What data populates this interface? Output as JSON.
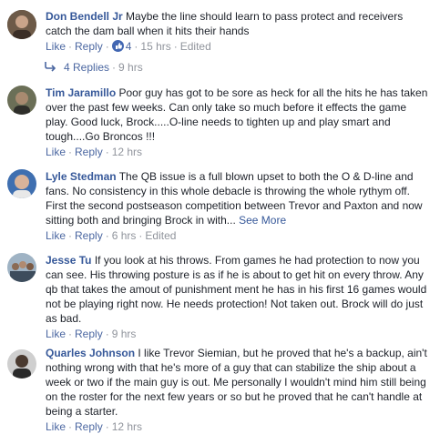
{
  "comments": [
    {
      "author": "Don Bendell Jr",
      "text": "Maybe the line should learn to pass protect and receivers catch the dam ball when it hits their hands",
      "like_label": "Like",
      "reply_label": "Reply",
      "reaction_count": "4",
      "time": "15 hrs",
      "edited": "Edited",
      "avatar_color": "#5a4a3c"
    },
    {
      "author": "Tim Jaramillo",
      "text": "Poor guy has got to be sore as heck for all the hits he has taken over the past few weeks. Can only take so much before it effects the game play. Good luck, Brock.....O-line needs to tighten up and play smart and tough....Go Broncos !!!",
      "like_label": "Like",
      "reply_label": "Reply",
      "time": "12 hrs",
      "avatar_color": "#6b6f57"
    },
    {
      "author": "Lyle Stedman",
      "text": "The QB issue is a full blown upset to both the O & D-line and fans. No consistency in this whole debacle is throwing the whole rythym off. First the second postseason competition between Trevor and Paxton and now sitting both and bringing Brock in with...",
      "see_more": "See More",
      "like_label": "Like",
      "reply_label": "Reply",
      "time": "6 hrs",
      "edited": "Edited",
      "avatar_color": "#3f6fb0"
    },
    {
      "author": "Jesse Tu",
      "text": "If you look at his throws. From games he had protection to now you can see. His throwing posture is as if he is about to get hit on every throw. Any qb that takes the amout of punishment ment he has in his first 16 games would not be playing right now. He needs protection! Not taken out. Brock will do just as bad.",
      "like_label": "Like",
      "reply_label": "Reply",
      "time": "9 hrs",
      "avatar_color": "#7a8c9a"
    },
    {
      "author": "Quarles Johnson",
      "text": "I like Trevor Siemian, but he proved that he's a backup, ain't nothing wrong with that he's more of a guy that can stabilize the ship about a week or two if the main guy is out. Me personally I wouldn't mind him still being on the roster for the next few years or so but he proved that he can't handle at being a starter.",
      "like_label": "Like",
      "reply_label": "Reply",
      "time": "12 hrs",
      "avatar_color": "#4a3a30"
    }
  ],
  "replies": {
    "label": "4 Replies",
    "time": "9 hrs"
  },
  "colors": {
    "author": "#365899",
    "meta": "#90949c",
    "link": "#4b67a1",
    "like_badge": "#4267b2"
  }
}
